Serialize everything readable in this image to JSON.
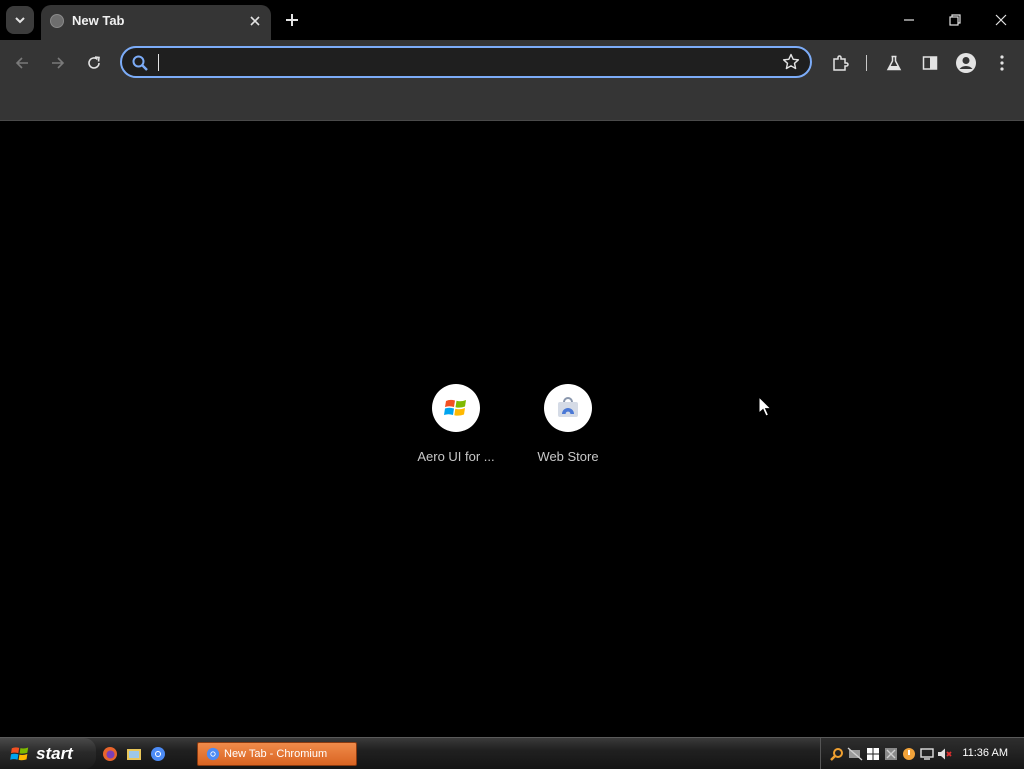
{
  "browser": {
    "tab": {
      "title": "New Tab"
    },
    "omnibox": {
      "value": "",
      "placeholder": ""
    }
  },
  "shortcuts": [
    {
      "label": "Aero UI for ...",
      "icon": "windows-logo-icon"
    },
    {
      "label": "Web Store",
      "icon": "web-store-icon"
    }
  ],
  "taskbar": {
    "start_label": "start",
    "task_item_label": "New Tab - Chromium",
    "clock": "11:36 AM",
    "quick_launch": [
      "firefox-icon",
      "file-manager-icon",
      "chromium-icon"
    ]
  },
  "colors": {
    "background": "#000000",
    "toolbar": "#353535",
    "omnibox_focus": "#7cacf8",
    "taskbar_item": "#e87a3a"
  }
}
